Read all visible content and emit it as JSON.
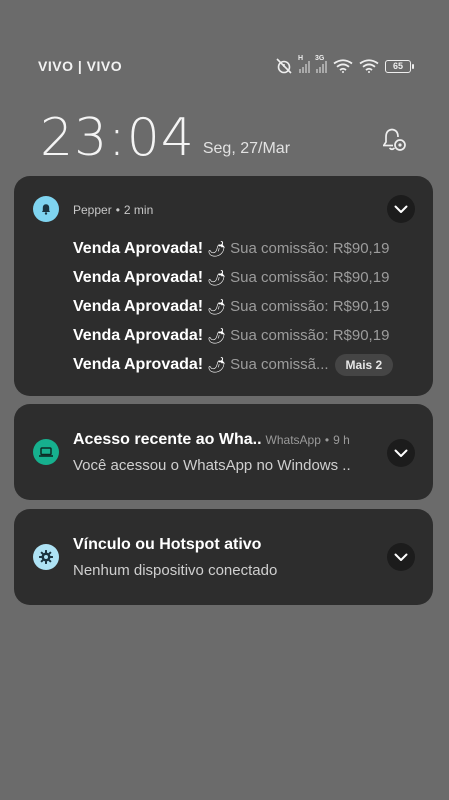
{
  "status_bar": {
    "carrier": "VIVO | VIVO",
    "network_badge_1": "H",
    "network_badge_2": "3G",
    "battery": "65"
  },
  "lockscreen": {
    "time": "23:04",
    "date": "Seg, 27/Mar"
  },
  "notifications": {
    "pepper": {
      "app_name": "Pepper",
      "time": "2 min",
      "lines": [
        {
          "title": "Venda Aprovada!",
          "emoji": "🌶",
          "body": "Sua comissão: R$90,19"
        },
        {
          "title": "Venda Aprovada!",
          "emoji": "🌶",
          "body": "Sua comissão: R$90,19"
        },
        {
          "title": "Venda Aprovada!",
          "emoji": "🌶",
          "body": "Sua comissão: R$90,19"
        },
        {
          "title": "Venda Aprovada!",
          "emoji": "🌶",
          "body": "Sua comissão: R$90,19"
        },
        {
          "title": "Venda Aprovada!",
          "emoji": "🌶",
          "body": "Sua comissã..."
        }
      ],
      "more_label": "Mais 2"
    },
    "whatsapp": {
      "title": "Acesso recente ao Wha..",
      "app_name": "WhatsApp",
      "time": "9 h",
      "text": "Você acessou o WhatsApp no Windows .."
    },
    "hotspot": {
      "title": "Vínculo ou Hotspot ativo",
      "text": "Nenhum dispositivo conectado"
    }
  },
  "colors": {
    "background": "#6b6b6b",
    "card": "#2d2d2d",
    "pepper_icon": "#7fd4f0",
    "whatsapp_icon": "#16b08e",
    "hotspot_icon": "#aee3f5"
  }
}
